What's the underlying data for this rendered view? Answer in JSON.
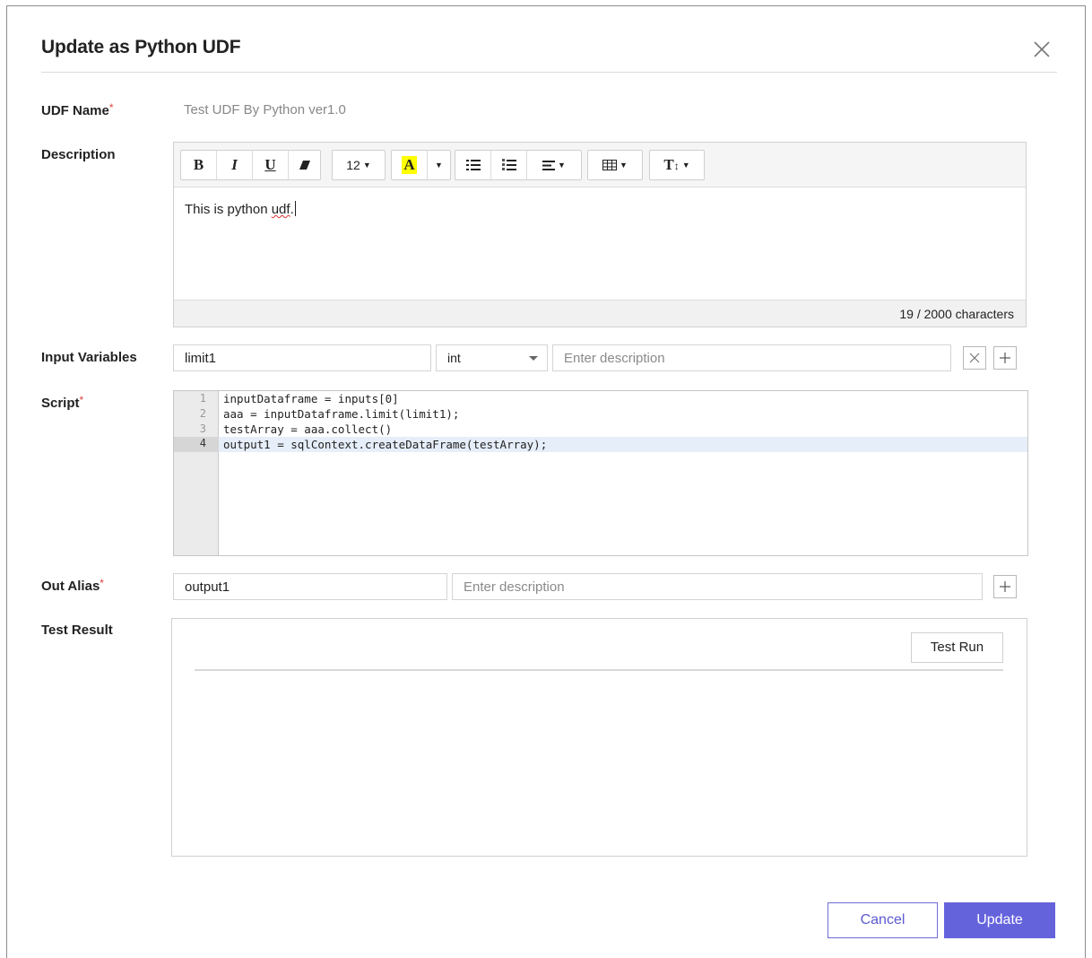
{
  "dialog": {
    "title": "Update as Python UDF"
  },
  "labels": {
    "udf_name": "UDF Name",
    "description": "Description",
    "input_variables": "Input Variables",
    "script": "Script",
    "out_alias": "Out Alias",
    "test_result": "Test Result",
    "required_mark": "*"
  },
  "udf_name_value": "Test UDF By Python ver1.0",
  "toolbar": {
    "bold": "B",
    "italic": "I",
    "underline": "U",
    "font_size": "12",
    "highlight": "A",
    "text_height": "T"
  },
  "description": {
    "text_before": "This is python ",
    "text_misspelled": "udf",
    "text_after": ".",
    "char_count": "19 / 2000 characters"
  },
  "input_variables": {
    "name": "limit1",
    "type": "int",
    "description_placeholder": "Enter description"
  },
  "script": {
    "lines": [
      {
        "no": "1",
        "code": "inputDataframe = inputs[0]"
      },
      {
        "no": "2",
        "code": "aaa = inputDataframe.limit(limit1);"
      },
      {
        "no": "3",
        "code": "testArray = aaa.collect()"
      },
      {
        "no": "4",
        "code": "output1 = sqlContext.createDataFrame(testArray);"
      }
    ],
    "active_line": 4
  },
  "out_alias": {
    "name": "output1",
    "description_placeholder": "Enter description"
  },
  "test_result": {
    "run_label": "Test Run"
  },
  "footer": {
    "cancel_label": "Cancel",
    "update_label": "Update"
  },
  "colors": {
    "primary": "#6563dc",
    "required": "#e0413a",
    "highlight_yellow": "#ffff00"
  }
}
